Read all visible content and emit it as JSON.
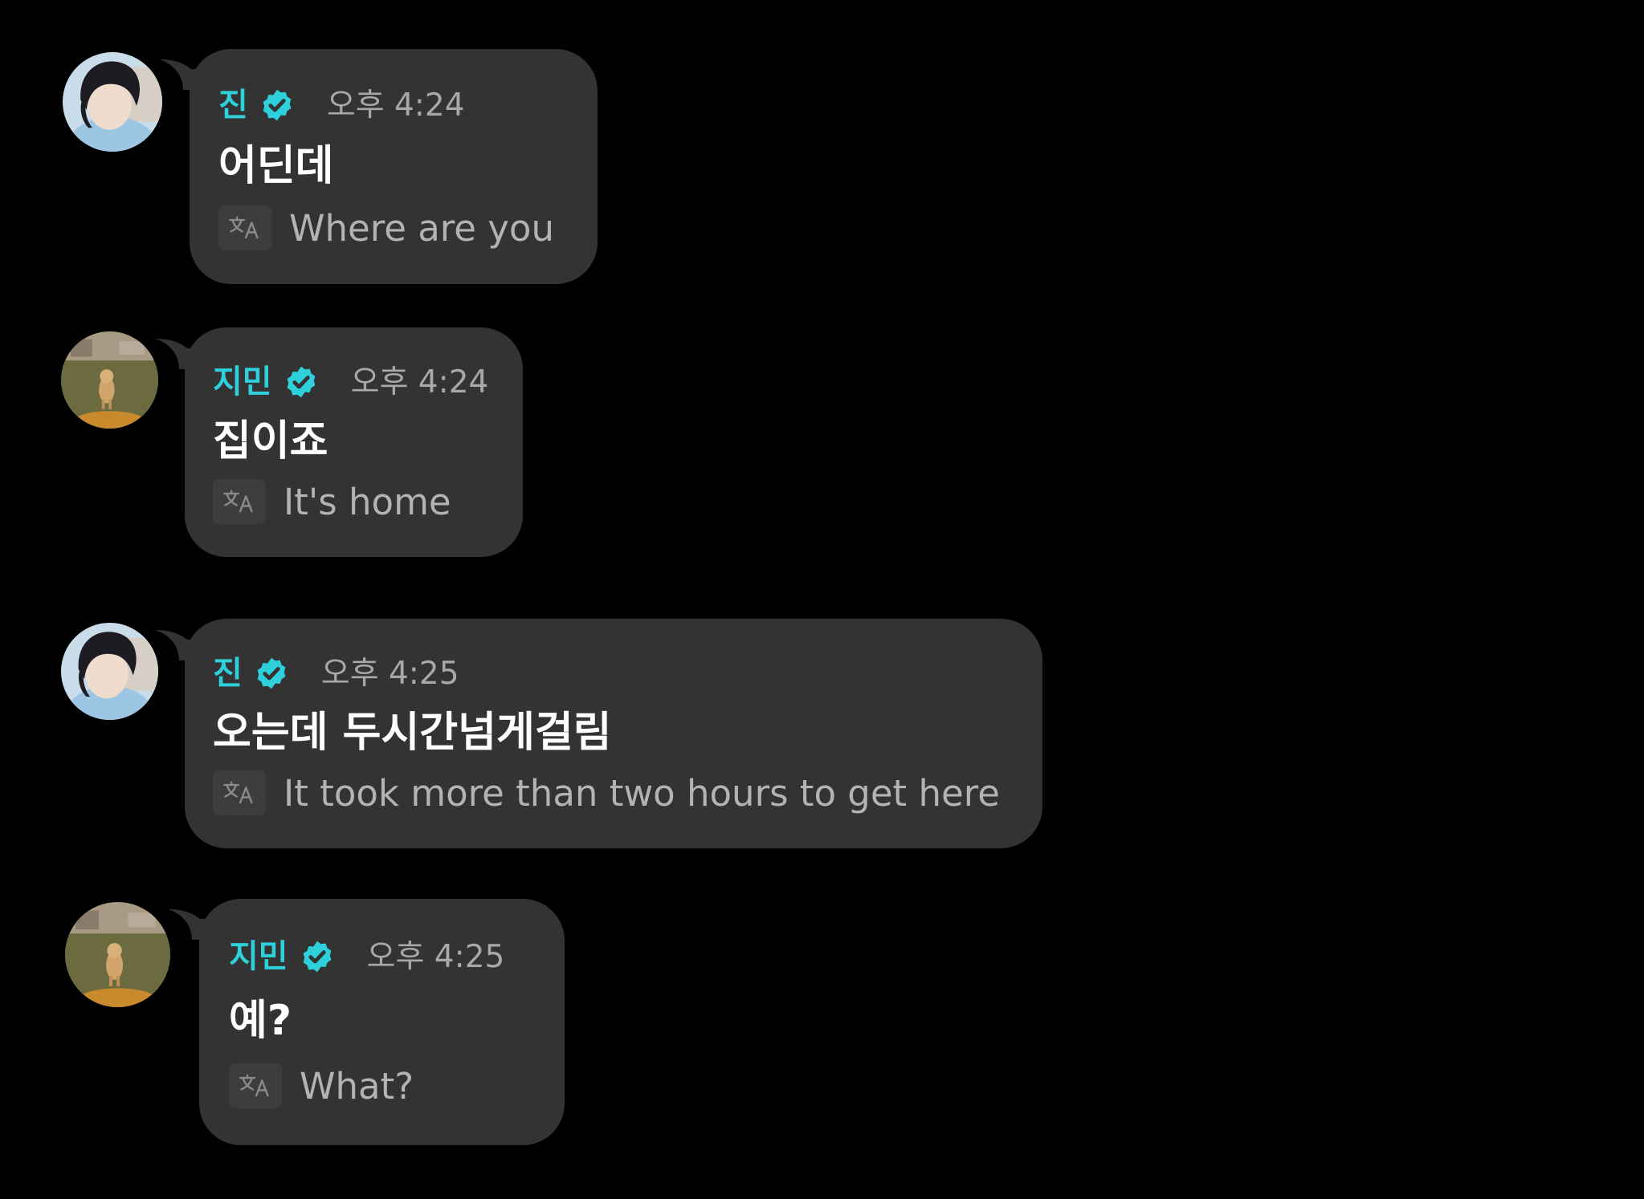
{
  "messages": [
    {
      "sender": "진",
      "time": "오후 4:24",
      "text": "어딘데",
      "translation": "Where are you",
      "avatar": "avatar-jin",
      "verified_icon": "verified-badge-icon",
      "translate_icon": "translate-icon"
    },
    {
      "sender": "지민",
      "time": "오후 4:24",
      "text": "집이죠",
      "translation": "It's home",
      "avatar": "avatar-jimin",
      "verified_icon": "verified-badge-icon",
      "translate_icon": "translate-icon"
    },
    {
      "sender": "진",
      "time": "오후 4:25",
      "text": "오는데 두시간넘게걸림",
      "translation": "It took more than two hours to get here",
      "avatar": "avatar-jin",
      "verified_icon": "verified-badge-icon",
      "translate_icon": "translate-icon"
    },
    {
      "sender": "지민",
      "time": "오후 4:25",
      "text": "예?",
      "translation": "What?",
      "avatar": "avatar-jimin",
      "verified_icon": "verified-badge-icon",
      "translate_icon": "translate-icon"
    }
  ],
  "colors": {
    "background": "#000000",
    "bubble": "#333333",
    "name": "#2ed0dc",
    "time": "#a8a8a8",
    "message_text": "#ffffff",
    "translation_text": "#b3b3b3",
    "verified_badge": "#2ed0dc"
  }
}
